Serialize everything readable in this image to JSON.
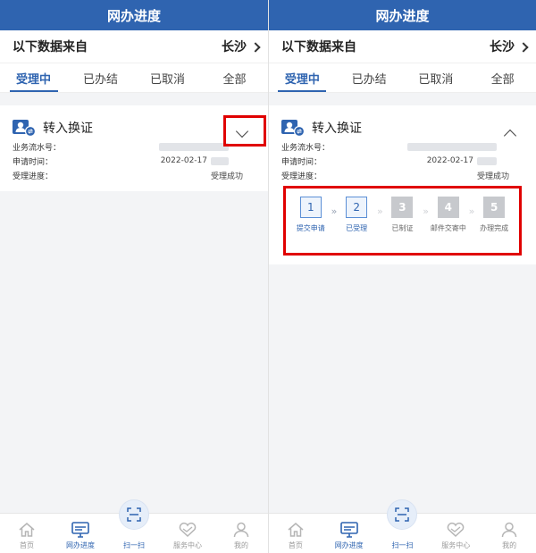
{
  "screens": [
    {
      "header_title": "网办进度",
      "source_label": "以下数据来自",
      "city": "长沙",
      "tabs": [
        {
          "label": "受理中",
          "active": true
        },
        {
          "label": "已办结"
        },
        {
          "label": "已取消"
        },
        {
          "label": "全部"
        }
      ],
      "card": {
        "title": "转入换证",
        "rows": [
          {
            "label": "业务流水号：",
            "value": ""
          },
          {
            "label": "申请时间：",
            "value": "2022-02-17"
          },
          {
            "label": "受理进度：",
            "value": "受理成功"
          }
        ],
        "expanded": false
      }
    },
    {
      "header_title": "网办进度",
      "source_label": "以下数据来自",
      "city": "长沙",
      "tabs": [
        {
          "label": "受理中",
          "active": true
        },
        {
          "label": "已办结"
        },
        {
          "label": "已取消"
        },
        {
          "label": "全部"
        }
      ],
      "card": {
        "title": "转入换证",
        "rows": [
          {
            "label": "业务流水号：",
            "value": ""
          },
          {
            "label": "申请时间：",
            "value": "2022-02-17"
          },
          {
            "label": "受理进度：",
            "value": "受理成功"
          }
        ],
        "expanded": true,
        "steps": [
          {
            "num": "1",
            "label": "提交申请",
            "state": "done"
          },
          {
            "num": "2",
            "label": "已受理",
            "state": "done"
          },
          {
            "num": "3",
            "label": "已制证",
            "state": "todo"
          },
          {
            "num": "4",
            "label": "邮件交寄中",
            "state": "todo"
          },
          {
            "num": "5",
            "label": "办理完成",
            "state": "todo"
          }
        ],
        "separator": "»"
      }
    }
  ],
  "bottom_nav": [
    {
      "label": "首页",
      "icon": "home-icon"
    },
    {
      "label": "网办进度",
      "icon": "monitor-icon",
      "active": true
    },
    {
      "label": "扫一扫",
      "icon": "scan-icon"
    },
    {
      "label": "服务中心",
      "icon": "heart-service-icon"
    },
    {
      "label": "我的",
      "icon": "user-icon"
    }
  ],
  "colors": {
    "primary": "#2f64b0",
    "highlight_frame": "#e00000",
    "inactive_step": "#c7c9cd"
  }
}
